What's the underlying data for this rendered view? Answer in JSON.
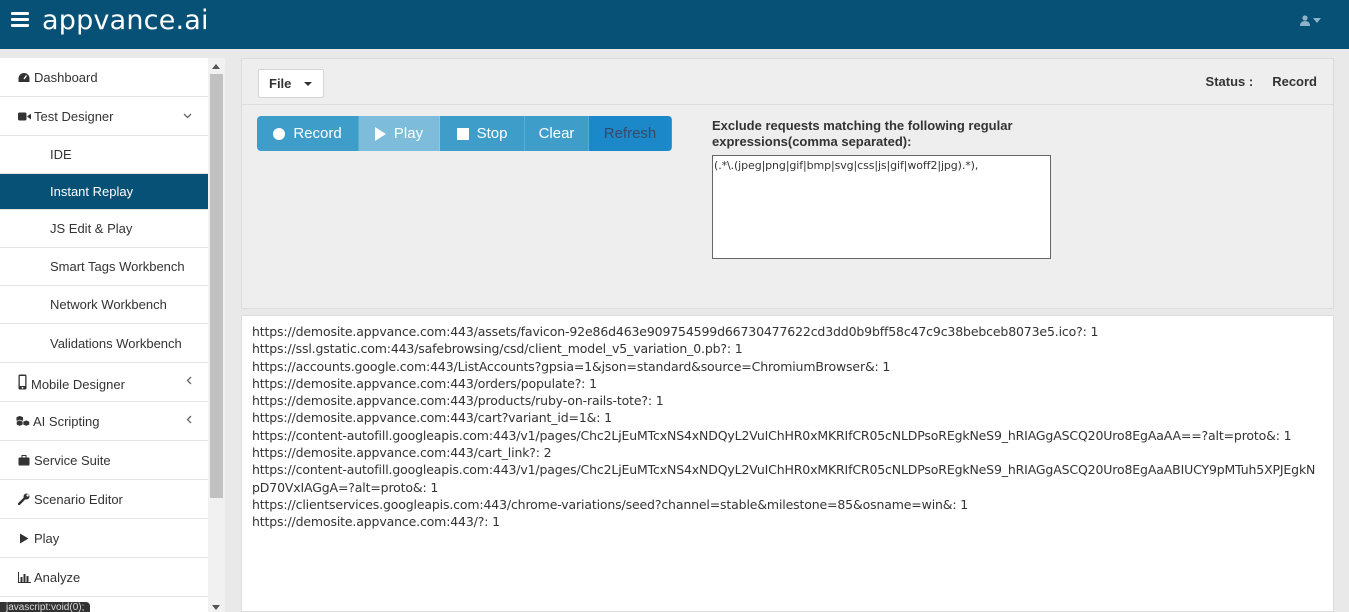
{
  "header": {
    "brand": "appvance.ai"
  },
  "sidebar": {
    "items": [
      {
        "label": "Dashboard",
        "icon": "dashboard-icon"
      },
      {
        "label": "Test Designer",
        "icon": "video-camera-icon",
        "chevron": "down"
      },
      {
        "label": "IDE"
      },
      {
        "label": "Instant Replay",
        "active": true
      },
      {
        "label": "JS Edit & Play"
      },
      {
        "label": "Smart Tags Workbench"
      },
      {
        "label": "Network Workbench"
      },
      {
        "label": "Validations Workbench"
      },
      {
        "label": "Mobile Designer",
        "icon": "mobile-icon",
        "chevron": "left"
      },
      {
        "label": "AI Scripting",
        "icon": "cubes-icon",
        "chevron": "left"
      },
      {
        "label": "Service Suite",
        "icon": "briefcase-icon"
      },
      {
        "label": "Scenario Editor",
        "icon": "wrench-icon"
      },
      {
        "label": "Play",
        "icon": "play-icon"
      },
      {
        "label": "Analyze",
        "icon": "bar-chart-icon"
      }
    ],
    "tooltip": "javascript:void(0);"
  },
  "panel": {
    "file_label": "File",
    "status_label": "Status :",
    "status_value": "Record",
    "buttons": {
      "record": "Record",
      "play": "Play",
      "stop": "Stop",
      "clear": "Clear",
      "refresh": "Refresh"
    },
    "exclude_label": "Exclude requests matching the following regular expressions(comma separated):",
    "exclude_value": "(.*\\.(jpeg|png|gif|bmp|svg|css|js|gif|woff2|jpg).*),"
  },
  "output": {
    "lines": [
      "https://demosite.appvance.com:443/assets/favicon-92e86d463e909754599d66730477622cd3dd0b9bff58c47c9c38bebceb8073e5.ico?: 1",
      "https://ssl.gstatic.com:443/safebrowsing/csd/client_model_v5_variation_0.pb?: 1",
      "https://accounts.google.com:443/ListAccounts?gpsia=1&json=standard&source=ChromiumBrowser&: 1",
      "https://demosite.appvance.com:443/orders/populate?: 1",
      "https://demosite.appvance.com:443/products/ruby-on-rails-tote?: 1",
      "https://demosite.appvance.com:443/cart?variant_id=1&: 1",
      "https://content-autofill.googleapis.com:443/v1/pages/Chc2LjEuMTcxNS4xNDQyL2VuIChHR0xMKRIfCR05cNLDPsoREgkNeS9_hRIAGgASCQ20Uro8EgAaAA==?alt=proto&: 1",
      "https://demosite.appvance.com:443/cart_link?: 2",
      "https://content-autofill.googleapis.com:443/v1/pages/Chc2LjEuMTcxNS4xNDQyL2VuIChHR0xMKRIfCR05cNLDPsoREgkNeS9_hRIAGgASCQ20Uro8EgAaABIUCY9pMTuh5XPJEgkNpD70VxIAGgA=?alt=proto&: 1",
      "https://clientservices.googleapis.com:443/chrome-variations/seed?channel=stable&milestone=85&osname=win&: 1",
      "https://demosite.appvance.com:443/?: 1"
    ]
  }
}
